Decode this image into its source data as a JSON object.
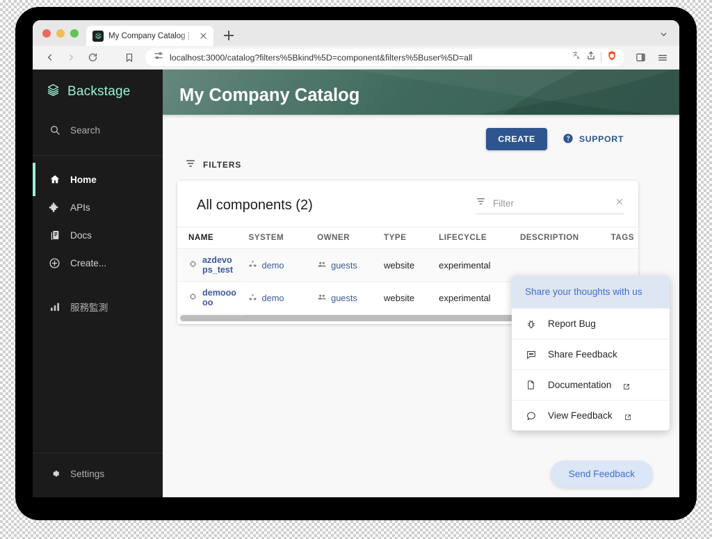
{
  "browser": {
    "tab_title": "My Company Catalog | Scaffo",
    "url": "localhost:3000/catalog?filters%5Bkind%5D=component&filters%5Buser%5D=all",
    "icons": {
      "back": "back-arrow-icon",
      "forward": "forward-arrow-icon",
      "reload": "reload-icon",
      "bookmark": "bookmark-icon",
      "site_settings": "site-settings-icon",
      "translate": "translate-icon",
      "share": "share-icon",
      "shields": "brave-shields-icon",
      "panel": "side-panel-icon",
      "menu": "hamburger-menu-icon",
      "new_tab": "new-tab-plus-icon",
      "tab_search": "tab-search-chevron-icon",
      "close_tab": "close-icon"
    }
  },
  "sidebar": {
    "brand": "Backstage",
    "groups": [
      {
        "items": [
          {
            "label": "Search",
            "icon": "search-icon",
            "active": false
          }
        ]
      },
      {
        "items": [
          {
            "label": "Home",
            "icon": "home-icon",
            "active": true
          },
          {
            "label": "APIs",
            "icon": "puzzle-icon",
            "active": false
          },
          {
            "label": "Docs",
            "icon": "docs-icon",
            "active": false
          },
          {
            "label": "Create...",
            "icon": "plus-circle-icon",
            "active": false
          }
        ]
      },
      {
        "items": [
          {
            "label": "服務監測",
            "icon": "bar-chart-icon",
            "active": false
          }
        ]
      }
    ],
    "footer": {
      "label": "Settings",
      "icon": "gear-icon"
    }
  },
  "page": {
    "title": "My Company Catalog",
    "create_button": "CREATE",
    "support_link": "SUPPORT",
    "support_icon": "help-circle-icon",
    "filters_label": "FILTERS",
    "filters_icon": "filter-list-icon"
  },
  "table": {
    "heading": "All components (2)",
    "filter_placeholder": "Filter",
    "filter_icon": "filter-list-icon",
    "clear_icon": "close-icon",
    "columns": [
      "NAME",
      "SYSTEM",
      "OWNER",
      "TYPE",
      "LIFECYCLE",
      "DESCRIPTION",
      "TAGS"
    ],
    "rows": [
      {
        "name": "azdevops_test",
        "name_icon": "component-icon",
        "system": "demo",
        "system_icon": "system-icon",
        "owner": "guests",
        "owner_icon": "group-icon",
        "type": "website",
        "lifecycle": "experimental",
        "description": "",
        "tags": ""
      },
      {
        "name": "demooooo",
        "name_icon": "component-icon",
        "system": "demo",
        "system_icon": "system-icon",
        "owner": "guests",
        "owner_icon": "group-icon",
        "type": "website",
        "lifecycle": "experimental",
        "description": "",
        "tags": ""
      }
    ]
  },
  "feedback": {
    "header": "Share your thoughts with us",
    "items": [
      {
        "label": "Report Bug",
        "icon": "bug-icon",
        "external": false
      },
      {
        "label": "Share Feedback",
        "icon": "comment-icon",
        "external": false
      },
      {
        "label": "Documentation",
        "icon": "document-icon",
        "external": true
      },
      {
        "label": "View Feedback",
        "icon": "chat-bubble-icon",
        "external": true
      }
    ],
    "fab_label": "Send Feedback"
  },
  "colors": {
    "sidebar_bg": "#1b1b1b",
    "brand_teal": "#9bf0d8",
    "header_green": "#356154",
    "accent_blue": "#2e558f",
    "link_blue": "#3c5a9a",
    "feedback_blue": "#3f6fd0",
    "feedback_bg": "#dfe6f3"
  }
}
